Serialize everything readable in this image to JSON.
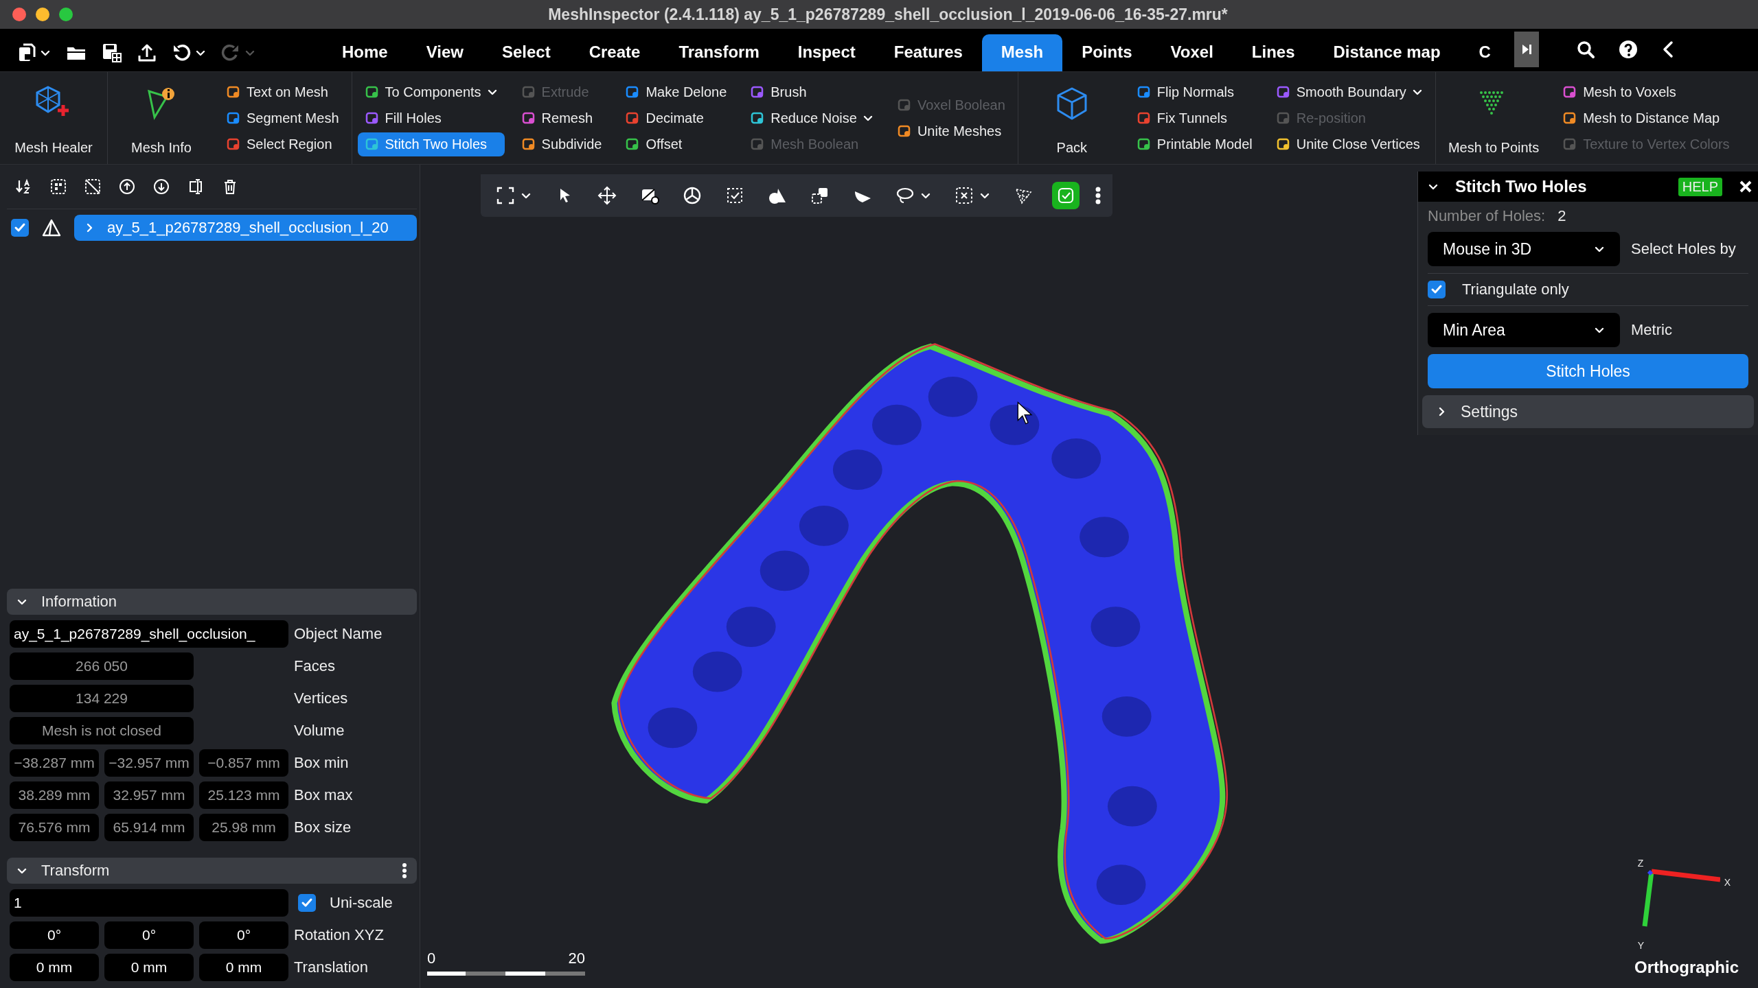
{
  "window": {
    "title": "MeshInspector (2.4.1.118) ay_5_1_p26787289_shell_occlusion_l_2019-06-06_16-35-27.mru*"
  },
  "menu_tabs": [
    {
      "label": "Home",
      "selected": false
    },
    {
      "label": "View",
      "selected": false
    },
    {
      "label": "Select",
      "selected": false
    },
    {
      "label": "Create",
      "selected": false
    },
    {
      "label": "Transform",
      "selected": false
    },
    {
      "label": "Inspect",
      "selected": false
    },
    {
      "label": "Features",
      "selected": false
    },
    {
      "label": "Mesh",
      "selected": true
    },
    {
      "label": "Points",
      "selected": false
    },
    {
      "label": "Voxel",
      "selected": false
    },
    {
      "label": "Lines",
      "selected": false
    },
    {
      "label": "Distance map",
      "selected": false
    },
    {
      "label": "C",
      "selected": false
    }
  ],
  "ribbon": {
    "sections": [
      {
        "groups": [
          {
            "kind": "big",
            "label": "Mesh Healer"
          }
        ]
      },
      {
        "groups": [
          {
            "kind": "big",
            "label": "Mesh Info"
          },
          {
            "kind": "column",
            "items": [
              {
                "label": "Text on Mesh",
                "disabled": false,
                "active": false,
                "dropdown": false
              },
              {
                "label": "Segment Mesh",
                "disabled": false,
                "active": false,
                "dropdown": false
              },
              {
                "label": "Select Region",
                "disabled": false,
                "active": false,
                "dropdown": false
              }
            ]
          }
        ]
      },
      {
        "groups": [
          {
            "kind": "column",
            "items": [
              {
                "label": "To Components",
                "disabled": false,
                "active": false,
                "dropdown": true
              },
              {
                "label": "Fill Holes",
                "disabled": false,
                "active": false,
                "dropdown": false
              },
              {
                "label": "Stitch Two Holes",
                "disabled": false,
                "active": true,
                "dropdown": false
              }
            ]
          },
          {
            "kind": "column",
            "items": [
              {
                "label": "Extrude",
                "disabled": true,
                "active": false,
                "dropdown": false
              },
              {
                "label": "Remesh",
                "disabled": false,
                "active": false,
                "dropdown": false
              },
              {
                "label": "Subdivide",
                "disabled": false,
                "active": false,
                "dropdown": false
              }
            ]
          },
          {
            "kind": "column",
            "items": [
              {
                "label": "Make Delone",
                "disabled": false,
                "active": false,
                "dropdown": false
              },
              {
                "label": "Decimate",
                "disabled": false,
                "active": false,
                "dropdown": false
              },
              {
                "label": "Offset",
                "disabled": false,
                "active": false,
                "dropdown": false
              }
            ]
          },
          {
            "kind": "column",
            "items": [
              {
                "label": "Brush",
                "disabled": false,
                "active": false,
                "dropdown": false
              },
              {
                "label": "Reduce Noise",
                "disabled": false,
                "active": false,
                "dropdown": true
              },
              {
                "label": "Mesh Boolean",
                "disabled": true,
                "active": false,
                "dropdown": false
              }
            ]
          },
          {
            "kind": "column",
            "items": [
              {
                "label": "Voxel Boolean",
                "disabled": true,
                "active": false,
                "dropdown": false
              },
              {
                "label": "Unite Meshes",
                "disabled": false,
                "active": false,
                "dropdown": false
              }
            ]
          }
        ]
      },
      {
        "groups": [
          {
            "kind": "big",
            "label": "Pack"
          },
          {
            "kind": "column",
            "items": [
              {
                "label": "Flip Normals",
                "disabled": false,
                "active": false,
                "dropdown": false
              },
              {
                "label": "Fix Tunnels",
                "disabled": false,
                "active": false,
                "dropdown": false
              },
              {
                "label": "Printable Model",
                "disabled": false,
                "active": false,
                "dropdown": false
              }
            ]
          },
          {
            "kind": "column",
            "items": [
              {
                "label": "Smooth Boundary",
                "disabled": false,
                "active": false,
                "dropdown": true
              },
              {
                "label": "Re-position",
                "disabled": true,
                "active": false,
                "dropdown": false
              },
              {
                "label": "Unite Close Vertices",
                "disabled": false,
                "active": false,
                "dropdown": false
              }
            ]
          }
        ]
      },
      {
        "groups": [
          {
            "kind": "big",
            "label": "Mesh to Points"
          },
          {
            "kind": "column",
            "items": [
              {
                "label": "Mesh to Voxels",
                "disabled": false,
                "active": false,
                "dropdown": false
              },
              {
                "label": "Mesh to Distance Map",
                "disabled": false,
                "active": false,
                "dropdown": false
              },
              {
                "label": "Texture to Vertex Colors",
                "disabled": true,
                "active": false,
                "dropdown": false
              }
            ]
          }
        ]
      }
    ]
  },
  "scene_tree": {
    "items": [
      {
        "label": "ay_5_1_p26787289_shell_occlusion_l_20",
        "visible": true,
        "selected": true,
        "expanded": false
      }
    ]
  },
  "information": {
    "title": "Information",
    "expanded": true,
    "rows": [
      {
        "kind": "wide",
        "label": "Object Name",
        "readonly": false,
        "values": [
          "ay_5_1_p26787289_shell_occlusion_"
        ]
      },
      {
        "kind": "half",
        "label": "Faces",
        "readonly": true,
        "values": [
          "266 050"
        ]
      },
      {
        "kind": "half",
        "label": "Vertices",
        "readonly": true,
        "values": [
          "134 229"
        ]
      },
      {
        "kind": "half",
        "label": "Volume",
        "readonly": true,
        "values": [
          "Mesh is not closed"
        ]
      },
      {
        "kind": "triple",
        "label": "Box min",
        "readonly": true,
        "values": [
          "−38.287 mm",
          "−32.957 mm",
          "−0.857 mm"
        ]
      },
      {
        "kind": "triple",
        "label": "Box max",
        "readonly": true,
        "values": [
          "38.289 mm",
          "32.957 mm",
          "25.123 mm"
        ]
      },
      {
        "kind": "triple",
        "label": "Box size",
        "readonly": true,
        "values": [
          "76.576 mm",
          "65.914 mm",
          "25.98 mm"
        ]
      }
    ]
  },
  "transform": {
    "title": "Transform",
    "expanded": true,
    "scale": {
      "value": "1",
      "uniform": true,
      "label": "Uni-scale"
    },
    "rows": [
      {
        "label": "Rotation XYZ",
        "values": [
          "0°",
          "0°",
          "0°"
        ]
      },
      {
        "label": "Translation",
        "values": [
          "0 mm",
          "0 mm",
          "0 mm"
        ]
      }
    ]
  },
  "viewport": {
    "toolbar": [
      {
        "dropdown": true,
        "active": false
      },
      {
        "dropdown": false,
        "active": false
      },
      {
        "dropdown": false,
        "active": false
      },
      {
        "dropdown": false,
        "active": false
      },
      {
        "dropdown": false,
        "active": false
      },
      {
        "dropdown": false,
        "active": false
      },
      {
        "dropdown": false,
        "active": false
      },
      {
        "dropdown": false,
        "active": false
      },
      {
        "dropdown": false,
        "active": false
      },
      {
        "dropdown": true,
        "active": false
      },
      {
        "dropdown": true,
        "active": false
      },
      {
        "dropdown": false,
        "active": false
      },
      {
        "dropdown": false,
        "active": true
      }
    ],
    "scale_bar": {
      "start": "0",
      "end": "20"
    },
    "axes": {
      "x": "X",
      "y": "Y",
      "z": "Z"
    },
    "projection": "Orthographic"
  },
  "tool_panel": {
    "title": "Stitch Two Holes",
    "expanded": true,
    "help": "HELP",
    "holes_label": "Number of Holes:",
    "holes_count": "2",
    "controls": [
      {
        "kind": "dropdown",
        "value": "Mouse in 3D",
        "label": "Select Holes by"
      },
      {
        "kind": "checkbox",
        "caption": "Triangulate only",
        "checked": true
      },
      {
        "kind": "dropdown",
        "value": "Min Area",
        "label": "Metric"
      }
    ],
    "action": "Stitch Holes",
    "settings": {
      "label": "Settings",
      "expanded": false
    }
  }
}
